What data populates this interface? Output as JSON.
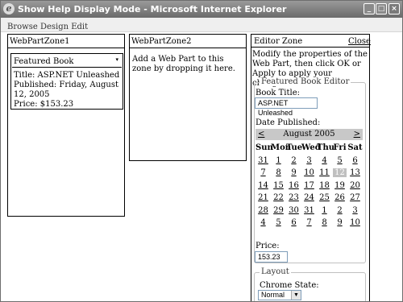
{
  "window": {
    "title": "Show Help Display Mode - Microsoft Internet Explorer",
    "icon": "ie-icon",
    "controls": {
      "minimize": "_",
      "maximize": "□",
      "close": "×"
    }
  },
  "display_modes": "Browse Design Edit",
  "zone1": {
    "title": "WebPartZone1",
    "part": {
      "title": "Featured Book",
      "menu_glyph": "▾",
      "lines": [
        "Title: ASP.NET Unleashed",
        "Published: Friday, August 12, 2005",
        "Price: $153.23"
      ]
    }
  },
  "zone2": {
    "title": "WebPartZone2",
    "empty_text": "Add a Web Part to this zone by dropping it here."
  },
  "editor": {
    "title": "Editor Zone",
    "close_label": "Close",
    "description": "Modify the properties of the Web Part, then click OK or Apply to apply your changes.",
    "book_editor": {
      "legend": "Featured Book Editor",
      "book_title_label": "Book Title:",
      "book_title_value": "ASP.NET Unleashed",
      "date_label": "Date Published:",
      "calendar": {
        "prev": "<",
        "next": ">",
        "month": "August 2005",
        "day_names": [
          "Sun",
          "Mon",
          "Tue",
          "Wed",
          "Thu",
          "Fri",
          "Sat"
        ],
        "weeks": [
          [
            "31",
            "1",
            "2",
            "3",
            "4",
            "5",
            "6"
          ],
          [
            "7",
            "8",
            "9",
            "10",
            "11",
            "12",
            "13"
          ],
          [
            "14",
            "15",
            "16",
            "17",
            "18",
            "19",
            "20"
          ],
          [
            "21",
            "22",
            "23",
            "24",
            "25",
            "26",
            "27"
          ],
          [
            "28",
            "29",
            "30",
            "31",
            "1",
            "2",
            "3"
          ],
          [
            "4",
            "5",
            "6",
            "7",
            "8",
            "9",
            "10"
          ]
        ],
        "selected_day": "12"
      },
      "price_label": "Price:",
      "price_value": "153.23"
    },
    "layout": {
      "legend": "Layout",
      "chrome_state_label": "Chrome State:",
      "chrome_state_value": "Normal"
    }
  }
}
